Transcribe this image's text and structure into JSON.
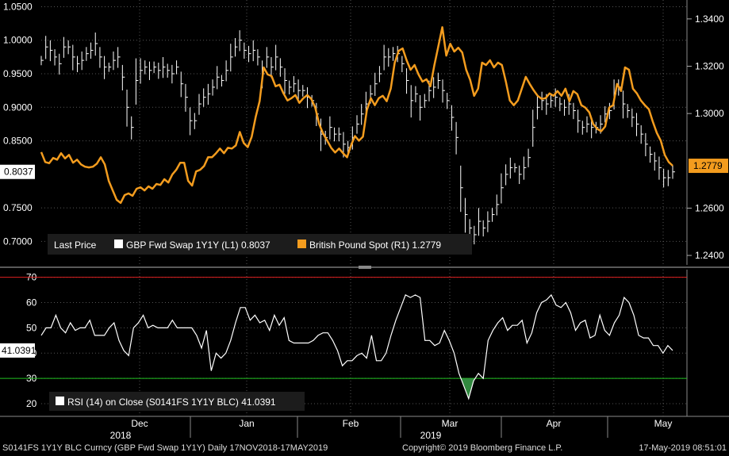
{
  "chart_data": [
    {
      "type": "line",
      "legend": {
        "label": "Last Price",
        "placement": "bottom-left",
        "entries": [
          {
            "name": "GBP Fwd Swap 1Y1Y",
            "axis": "(L1)",
            "last": "0.8037",
            "color": "#ffffff"
          },
          {
            "name": "British Pound Spot",
            "axis": "(R1)",
            "last": "1.2779",
            "color": "#f39c1e"
          }
        ]
      },
      "left_axis": {
        "ylim": [
          0.665,
          1.06
        ],
        "ticks": [
          "1.0500",
          "1.0000",
          "0.9500",
          "0.9000",
          "0.8500",
          "0.7500",
          "0.7000"
        ],
        "last_label": "0.8037"
      },
      "right_axis": {
        "ylim": [
          1.236,
          1.348
        ],
        "ticks": [
          "1.3400",
          "1.3200",
          "1.3000",
          "1.2600",
          "1.2400"
        ],
        "last_label": "1.2779"
      },
      "series": [
        {
          "name": "GBP Fwd Swap 1Y1Y",
          "style": "hlc-bars",
          "color": "#ffffff",
          "values": [
            0.97,
            0.99,
            0.985,
            0.975,
            0.965,
            0.99,
            0.99,
            0.975,
            0.965,
            0.97,
            0.98,
            0.985,
            0.995,
            0.975,
            0.96,
            0.96,
            0.97,
            0.975,
            0.945,
            0.9,
            0.87,
            0.94,
            0.955,
            0.96,
            0.955,
            0.96,
            0.955,
            0.96,
            0.955,
            0.95,
            0.96,
            0.935,
            0.915,
            0.88,
            0.88,
            0.905,
            0.915,
            0.92,
            0.93,
            0.945,
            0.94,
            0.955,
            0.975,
            0.99,
            1.0,
            0.985,
            0.98,
            0.985,
            0.975,
            0.95,
            0.975,
            0.96,
            0.975,
            0.96,
            0.94,
            0.93,
            0.935,
            0.925,
            0.925,
            0.915,
            0.91,
            0.89,
            0.86,
            0.855,
            0.87,
            0.86,
            0.86,
            0.845,
            0.84,
            0.855,
            0.875,
            0.89,
            0.905,
            0.92,
            0.935,
            0.95,
            0.975,
            0.975,
            0.98,
            0.98,
            0.965,
            0.94,
            0.91,
            0.92,
            0.9,
            0.91,
            0.925,
            0.93,
            0.94,
            0.925,
            0.91,
            0.885,
            0.855,
            0.78,
            0.74,
            0.72,
            0.71,
            0.73,
            0.72,
            0.73,
            0.74,
            0.755,
            0.78,
            0.8,
            0.81,
            0.81,
            0.8,
            0.81,
            0.825,
            0.87,
            0.9,
            0.91,
            0.905,
            0.91,
            0.915,
            0.905,
            0.9,
            0.905,
            0.895,
            0.88,
            0.87,
            0.875,
            0.87,
            0.87,
            0.875,
            0.89,
            0.895,
            0.92,
            0.93,
            0.905,
            0.895,
            0.885,
            0.875,
            0.86,
            0.845,
            0.83,
            0.82,
            0.81,
            0.795,
            0.795,
            0.8037
          ]
        },
        {
          "name": "British Pound Spot",
          "style": "line",
          "color": "#f39c1e",
          "values": [
            1.2837,
            1.2795,
            1.279,
            1.2812,
            1.2805,
            1.2832,
            1.281,
            1.2825,
            1.2792,
            1.2805,
            1.2785,
            1.2775,
            1.2772,
            1.2775,
            1.2788,
            1.2815,
            1.2785,
            1.2715,
            1.2675,
            1.2635,
            1.2622,
            1.2655,
            1.2662,
            1.2652,
            1.2682,
            1.2688,
            1.2675,
            1.2692,
            1.2682,
            1.2702,
            1.2698,
            1.2722,
            1.2708,
            1.2742,
            1.2762,
            1.2792,
            1.2792,
            1.2715,
            1.2695,
            1.2755,
            1.2762,
            1.2778,
            1.2815,
            1.2815,
            1.2832,
            1.2852,
            1.2832,
            1.2855,
            1.2852,
            1.2865,
            1.2922,
            1.2875,
            1.2858,
            1.2902,
            1.2985,
            1.3052,
            1.3195,
            1.3165,
            1.3158,
            1.3115,
            1.3122,
            1.3085,
            1.3055,
            1.3065,
            1.3078,
            1.3045,
            1.3065,
            1.3078,
            1.3062,
            1.3025,
            1.2955,
            1.2915,
            1.2885,
            1.2855,
            1.2835,
            1.2852,
            1.2832,
            1.2815,
            1.2865,
            1.2905,
            1.2885,
            1.2902,
            1.3015,
            1.3065,
            1.3035,
            1.3065,
            1.3075,
            1.3052,
            1.3105,
            1.3215,
            1.3265,
            1.3275,
            1.3225,
            1.3185,
            1.3205,
            1.3165,
            1.3135,
            1.3145,
            1.3115,
            1.3205,
            1.3285,
            1.3365,
            1.3245,
            1.3295,
            1.3262,
            1.3278,
            1.3258,
            1.3185,
            1.3142,
            1.3075,
            1.3105,
            1.3215,
            1.3205,
            1.3225,
            1.3195,
            1.3215,
            1.3205,
            1.3135,
            1.3055,
            1.3035,
            1.3055,
            1.3105,
            1.3155,
            1.3125,
            1.3098,
            1.3075,
            1.3062,
            1.3065,
            1.3085,
            1.3075,
            1.3095,
            1.3075,
            1.3105,
            1.3052,
            1.3095,
            1.3082,
            1.3035,
            1.3025,
            1.3005,
            1.2955,
            1.2935,
            1.2925,
            1.2945,
            1.3025,
            1.3035,
            1.3125,
            1.3095,
            1.3195,
            1.3185,
            1.3105,
            1.3085,
            1.3055,
            1.3035,
            1.3018,
            1.2965,
            1.2918,
            1.2885,
            1.2825,
            1.2795,
            1.2779
          ]
        }
      ]
    },
    {
      "type": "line",
      "legend": {
        "label": "RSI (14)  on Close (S0141FS 1Y1Y BLC) 41.0391",
        "placement": "bottom-left"
      },
      "ylim": [
        15,
        73
      ],
      "ticks": [
        "70",
        "60",
        "50",
        "40",
        "30",
        "20"
      ],
      "reference_lines": [
        {
          "value": 70,
          "color": "#e02020"
        },
        {
          "value": 30,
          "color": "#22c020"
        }
      ],
      "last_label": "41.0391",
      "series": [
        {
          "name": "RSI (14)",
          "color": "#ffffff",
          "values": [
            47,
            50,
            50,
            55,
            50,
            48,
            52,
            49,
            50,
            50,
            53,
            47,
            47,
            47,
            50,
            52,
            45,
            41,
            39,
            50,
            52,
            55,
            50,
            51,
            50,
            50,
            50,
            53,
            50,
            50,
            50,
            50,
            47,
            42,
            49,
            33,
            40,
            38,
            40,
            45,
            52,
            58,
            58,
            53,
            55,
            52,
            53,
            49,
            55,
            51,
            54,
            45,
            44,
            44,
            44,
            44,
            45,
            47,
            48,
            48,
            45,
            41,
            35,
            37,
            37,
            39,
            40,
            38,
            47,
            37,
            37,
            40,
            47,
            53,
            58,
            63,
            62,
            63,
            62,
            45,
            45,
            43,
            44,
            49,
            45,
            40,
            32,
            27,
            22,
            29,
            32,
            30,
            45,
            49,
            52,
            54,
            49,
            51,
            51,
            53,
            44,
            48,
            56,
            60,
            61,
            63,
            59,
            58,
            60,
            56,
            49,
            52,
            53,
            46,
            47,
            55,
            49,
            47,
            52,
            55,
            62,
            60,
            55,
            47,
            46,
            46,
            43,
            43,
            40,
            43,
            41.0391
          ]
        }
      ]
    }
  ],
  "x_axis": {
    "months": [
      {
        "label": "Dec",
        "year": "2018"
      },
      {
        "label": "Jan",
        "year": ""
      },
      {
        "label": "Feb",
        "year": ""
      },
      {
        "label": "Mar",
        "year": "2019"
      },
      {
        "label": "Apr",
        "year": ""
      },
      {
        "label": "May",
        "year": ""
      }
    ]
  },
  "footer": {
    "security": "S0141FS 1Y1Y BLC Curncy (GBP Fwd Swap 1Y1Y)  Daily 17NOV2018-17MAY2019",
    "copyright": "Copyright© 2019 Bloomberg Finance L.P.",
    "timestamp": "17-May-2019 08:51:01"
  },
  "colors": {
    "background": "#000000",
    "swap": "#ffffff",
    "spot": "#f39c1e",
    "rsi_upper": "#e02020",
    "rsi_lower": "#22c020",
    "grid": "#555555"
  }
}
